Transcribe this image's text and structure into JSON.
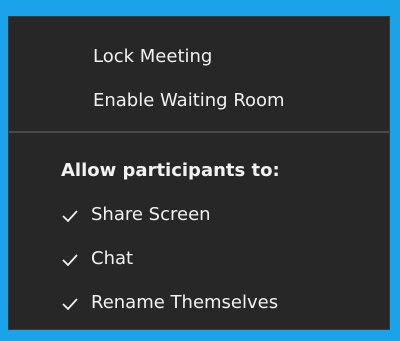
{
  "menu": {
    "items": [
      {
        "label": "Lock Meeting"
      },
      {
        "label": "Enable Waiting Room"
      }
    ],
    "section_heading": "Allow participants to:",
    "options": [
      {
        "label": "Share Screen",
        "checked": true,
        "icon": "checkmark-icon"
      },
      {
        "label": "Chat",
        "checked": true,
        "icon": "checkmark-icon"
      },
      {
        "label": "Rename Themselves",
        "checked": true,
        "icon": "checkmark-icon"
      }
    ]
  },
  "colors": {
    "background_accent": "#1aa3e8",
    "menu_background": "#272727",
    "text": "#f2f2f2",
    "divider": "#4a4a4a"
  }
}
